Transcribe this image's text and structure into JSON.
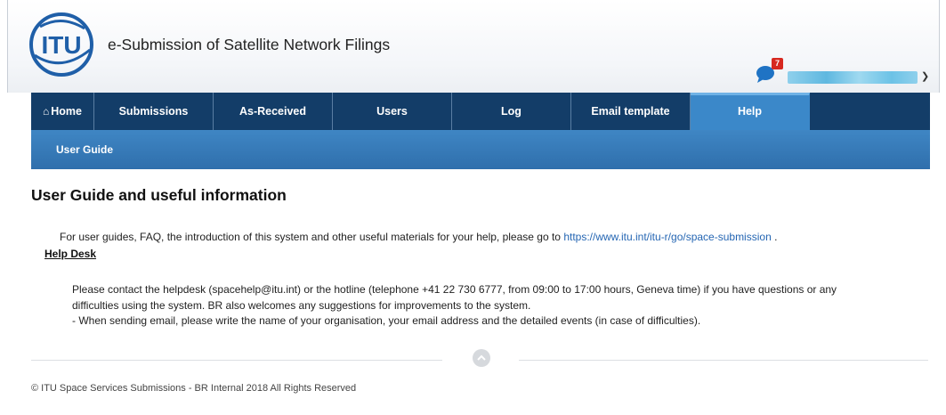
{
  "header": {
    "app_title": "e-Submission of Satellite Network Filings",
    "logo_text": "ITU",
    "notification_count": "7"
  },
  "nav": {
    "items": [
      {
        "label": "Home",
        "icon": "home-icon"
      },
      {
        "label": "Submissions"
      },
      {
        "label": "As-Received"
      },
      {
        "label": "Users"
      },
      {
        "label": "Log"
      },
      {
        "label": "Email template"
      },
      {
        "label": "Help",
        "active": true
      }
    ]
  },
  "subnav": {
    "items": [
      {
        "label": "User Guide"
      }
    ]
  },
  "content": {
    "title": "User Guide and useful information",
    "intro_prefix": "For user guides, FAQ, the introduction of this system and other useful materials for your help, please go to",
    "intro_link": "https://www.itu.int/itu-r/go/space-submission",
    "intro_suffix": ".",
    "helpdesk_heading": "Help Desk",
    "helpdesk_line1": "Please contact the helpdesk (spacehelp@itu.int) or the hotline (telephone +41 22 730 6777, from 09:00 to 17:00 hours, Geneva time) if you have questions or any",
    "helpdesk_line2": "difficulties using the system. BR also welcomes any suggestions for improvements to the system.",
    "helpdesk_line3": "- When sending email, please write the name of your organisation, your email address and the detailed events (in case of difficulties)."
  },
  "footer": {
    "text": "© ITU Space Services Submissions - BR Internal 2018 All Rights Reserved"
  },
  "colors": {
    "nav_bg": "#133d68",
    "nav_active": "#3b88c9",
    "subnav_bg": "#2f6fac",
    "link": "#2566b3",
    "badge": "#d7281f"
  }
}
